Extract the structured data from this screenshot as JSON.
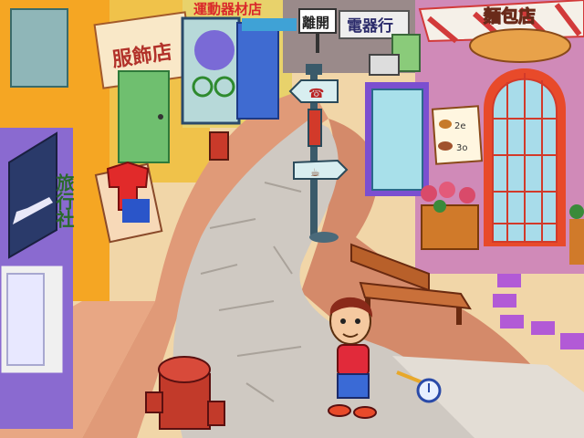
{
  "scene": {
    "name": "town-street"
  },
  "signs": {
    "clothing_store": "服飾店",
    "sports_store": "運動器材店",
    "exit": "離開",
    "electronics_store": "電器行",
    "bakery": "麵包店",
    "travel_agency": "旅行社"
  },
  "bakery_menu": {
    "item1_price": "2e",
    "item2_price": "3o"
  },
  "colors": {
    "sky_building": "#f4a51c",
    "road": "#e0a07a",
    "sidewalk": "#c9c2b8",
    "accent_red": "#d9262a",
    "accent_blue": "#2f6fd6"
  }
}
